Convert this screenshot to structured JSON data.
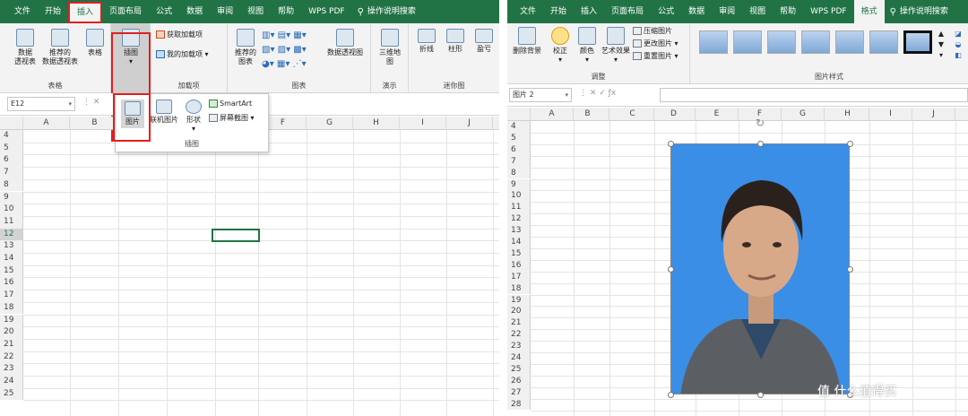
{
  "left": {
    "tabs": [
      "文件",
      "开始",
      "插入",
      "页面布局",
      "公式",
      "数据",
      "审阅",
      "视图",
      "帮助",
      "WPS PDF",
      "操作说明搜索"
    ],
    "active_tab_index": 2,
    "groups": {
      "table": {
        "label": "表格",
        "pivot": "数据透视表",
        "pivot_l1": "数据",
        "pivot_l2": "透视表",
        "rec_pivot_l1": "推荐的",
        "rec_pivot_l2": "数据透视表",
        "table": "表格"
      },
      "illustrations": {
        "label": "插图",
        "button": "插图"
      },
      "addins": {
        "label": "加载项",
        "get": "获取加载项",
        "mine": "我的加载项"
      },
      "charts": {
        "label": "图表",
        "rec_l1": "推荐的",
        "rec_l2": "图表",
        "pivot_chart": "数据透视图"
      },
      "tours": {
        "label": "演示",
        "map_l1": "三维地",
        "map_l2": "图"
      },
      "spark": {
        "label": "迷你图",
        "line": "折线",
        "col": "柱形",
        "winloss": "盈亏"
      }
    },
    "dropdown": {
      "picture": "图片",
      "online": "联机图片",
      "shapes": "形状",
      "smartart": "SmartArt",
      "screenshot": "屏幕截图",
      "label": "插图"
    },
    "name_box": "E12",
    "columns": [
      "A",
      "B",
      "C",
      "D",
      "E",
      "F",
      "G",
      "H",
      "I",
      "J"
    ],
    "rows": [
      "4",
      "5",
      "6",
      "7",
      "8",
      "9",
      "10",
      "11",
      "12",
      "13",
      "14",
      "15",
      "16",
      "17",
      "18",
      "19",
      "20",
      "21",
      "22",
      "23",
      "24",
      "25"
    ]
  },
  "right": {
    "tabs": [
      "文件",
      "开始",
      "插入",
      "页面布局",
      "公式",
      "数据",
      "审阅",
      "视图",
      "帮助",
      "WPS PDF",
      "格式",
      "操作说明搜索"
    ],
    "active_tab_index": 10,
    "adjust": {
      "label": "调整",
      "remove_bg": "删除背景",
      "correct": "校正",
      "color": "颜色",
      "artistic": "艺术效果",
      "compress": "压缩图片",
      "change": "更改图片",
      "reset": "重置图片"
    },
    "styles": {
      "label": "图片样式"
    },
    "name_box": "图片 2",
    "columns": [
      "A",
      "B",
      "C",
      "D",
      "E",
      "F",
      "G",
      "H",
      "I",
      "J"
    ],
    "rows": [
      "4",
      "5",
      "6",
      "7",
      "8",
      "9",
      "10",
      "11",
      "12",
      "13",
      "14",
      "15",
      "16",
      "17",
      "18",
      "19",
      "20",
      "21",
      "22",
      "23",
      "24",
      "25",
      "26",
      "27",
      "28"
    ]
  },
  "watermark": "值 什么值得买",
  "colors": {
    "ribbon_green": "#217346",
    "highlight_red": "#e02020",
    "photo_bg": "#3a8ee6"
  }
}
